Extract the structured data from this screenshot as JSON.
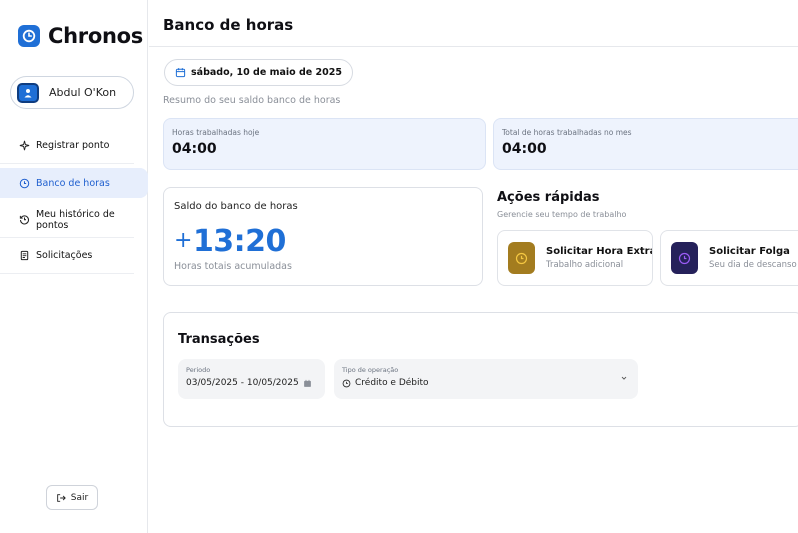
{
  "app": {
    "name": "Chronos"
  },
  "user": {
    "name": "Abdul O'Kon"
  },
  "nav": {
    "items": [
      {
        "label": "Registrar ponto",
        "icon": "sparkle-icon",
        "active": false
      },
      {
        "label": "Banco de horas",
        "icon": "clock-icon",
        "active": true
      },
      {
        "label": "Meu histórico de pontos",
        "icon": "history-icon",
        "active": false
      },
      {
        "label": "Solicitações",
        "icon": "receipt-icon",
        "active": false
      }
    ],
    "logout_label": "Sair"
  },
  "header": {
    "title": "Banco de horas"
  },
  "main": {
    "date": "sábado, 10 de maio de 2025",
    "subtitle": "Resumo do seu saldo banco de horas",
    "stats": [
      {
        "label": "Horas trabalhadas hoje",
        "value": "04:00"
      },
      {
        "label": "Total de horas trabalhadas no mes",
        "value": "04:00"
      }
    ],
    "balance": {
      "title": "Saldo do banco de horas",
      "sign": "+",
      "value": "13:20",
      "subtitle": "Horas totais acumuladas"
    },
    "quick_actions": {
      "title": "Ações rápidas",
      "subtitle": "Gerencie seu tempo de trabalho",
      "items": [
        {
          "label": "Solicitar Hora Extra",
          "description": "Trabalho adicional",
          "icon": "clock-icon",
          "color": "#a37c1f"
        },
        {
          "label": "Solicitar Folga",
          "description": "Seu dia de descanso",
          "icon": "clock-icon",
          "color": "#25215a"
        }
      ]
    },
    "transactions": {
      "title": "Transações",
      "period": {
        "label": "Periodo",
        "value": "03/05/2025 - 10/05/2025"
      },
      "operation": {
        "label": "Tipo de operação",
        "value": "Crédito e Débito"
      }
    }
  },
  "colors": {
    "accent": "#1f6fd6",
    "active_nav_bg": "#e7eefc",
    "stat_bg": "#eef3fd"
  }
}
